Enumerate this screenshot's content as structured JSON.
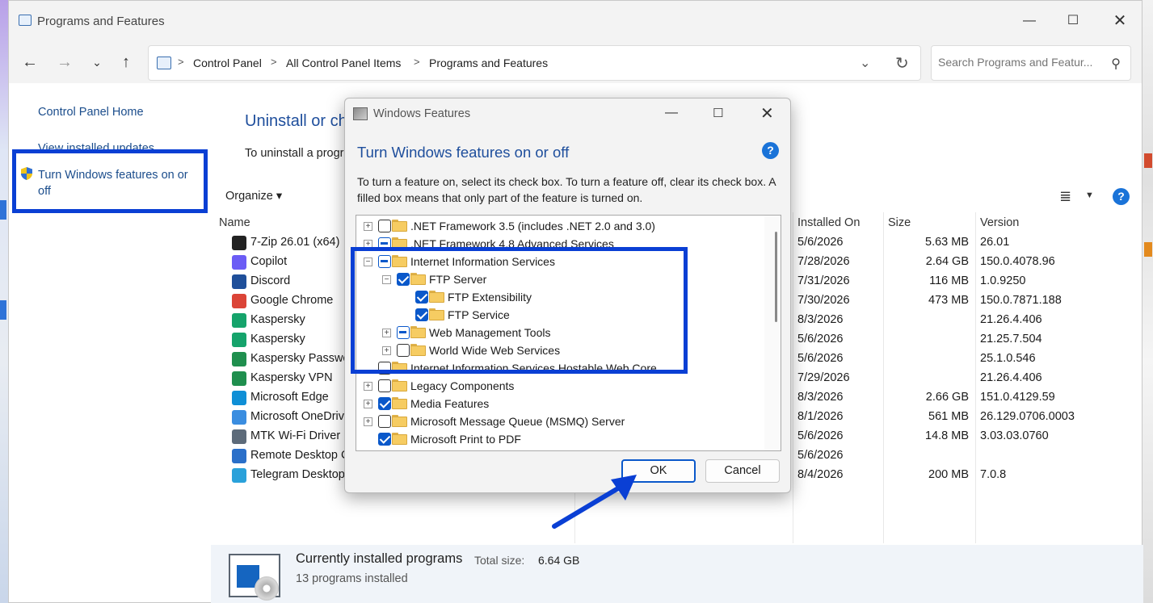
{
  "main_window": {
    "title": "Programs and Features",
    "minimize": "—",
    "maximize": "☐",
    "close": "✕"
  },
  "navigation": {
    "back": "←",
    "forward": "→",
    "recent": "⌄",
    "up": "↑",
    "breadcrumb": [
      "Control Panel",
      "All Control Panel Items",
      "Programs and Features"
    ],
    "breadcrumb_separator": ">",
    "dropdown": "⌄",
    "refresh": "↻",
    "search_placeholder": "Search Programs and Featur..."
  },
  "left_pane": {
    "home": "Control Panel Home",
    "updates": "View installed updates",
    "features": "Turn Windows features on or off"
  },
  "content": {
    "title": "Uninstall or change a program",
    "description": "To uninstall a program, select it from the list and then click Uninstall, Change, or Repair.",
    "organize": "Organize ▾",
    "columns": {
      "name": "Name",
      "installed_on": "Installed On",
      "size": "Size",
      "version": "Version"
    },
    "programs": [
      {
        "name": "7-Zip 26.01 (x64)",
        "date": "5/6/2026",
        "size": "5.63 MB",
        "version": "26.01",
        "icon_color": "#222222",
        "icon": "7zip-icon"
      },
      {
        "name": "Copilot",
        "date": "7/28/2026",
        "size": "2.64 GB",
        "version": "150.0.4078.96",
        "icon_color": "#6b5cf5",
        "icon": "copilot-icon"
      },
      {
        "name": "Discord",
        "date": "7/31/2026",
        "size": "116 MB",
        "version": "1.0.9250",
        "icon_color": "#1f4f9a",
        "icon": "discord-icon"
      },
      {
        "name": "Google Chrome",
        "date": "7/30/2026",
        "size": "473 MB",
        "version": "150.0.7871.188",
        "icon_color": "#db4437",
        "icon": "chrome-icon"
      },
      {
        "name": "Kaspersky",
        "date": "8/3/2026",
        "size": "",
        "version": "21.26.4.406",
        "icon_color": "#15a36b",
        "icon": "kaspersky-icon"
      },
      {
        "name": "Kaspersky",
        "date": "5/6/2026",
        "size": "",
        "version": "21.25.7.504",
        "icon_color": "#15a36b",
        "icon": "kaspersky-icon"
      },
      {
        "name": "Kaspersky Password Manager",
        "date": "5/6/2026",
        "size": "",
        "version": "25.1.0.546",
        "icon_color": "#1f8f4e",
        "icon": "kaspersky-password-icon"
      },
      {
        "name": "Kaspersky VPN",
        "date": "7/29/2026",
        "size": "",
        "version": "21.26.4.406",
        "icon_color": "#1f8f4e",
        "icon": "kaspersky-vpn-icon"
      },
      {
        "name": "Microsoft Edge",
        "date": "8/3/2026",
        "size": "2.66 GB",
        "version": "151.0.4129.59",
        "icon_color": "#0f8fd6",
        "icon": "edge-icon"
      },
      {
        "name": "Microsoft OneDrive",
        "date": "8/1/2026",
        "size": "561 MB",
        "version": "26.129.0706.0003",
        "icon_color": "#3a8de0",
        "icon": "onedrive-icon"
      },
      {
        "name": "MTK Wi-Fi Driver",
        "date": "5/6/2026",
        "size": "14.8 MB",
        "version": "3.03.03.0760",
        "icon_color": "#5d6b7a",
        "icon": "wifi-driver-icon"
      },
      {
        "name": "Remote Desktop Connection",
        "date": "5/6/2026",
        "size": "",
        "version": "",
        "icon_color": "#2a6fc9",
        "icon": "remote-desktop-icon"
      },
      {
        "name": "Telegram Desktop",
        "date": "8/4/2026",
        "size": "200 MB",
        "version": "7.0.8",
        "icon_color": "#2aa1da",
        "icon": "telegram-icon"
      }
    ]
  },
  "status_bar": {
    "title": "Currently installed programs",
    "total_label": "Total size:",
    "total_value": "6.64 GB",
    "count": "13 programs installed"
  },
  "dialog": {
    "title": "Windows Features",
    "minimize": "—",
    "maximize": "☐",
    "close": "✕",
    "heading": "Turn Windows features on or off",
    "help": "?",
    "description": "To turn a feature on, select its check box. To turn a feature off, clear its check box. A filled box means that only part of the feature is turned on.",
    "features": [
      {
        "label": ".NET Framework 3.5 (includes .NET 2.0 and 3.0)",
        "level": 0,
        "expander": "+",
        "state": "unchecked"
      },
      {
        "label": ".NET Framework 4.8 Advanced Services",
        "level": 0,
        "expander": "+",
        "state": "partial"
      },
      {
        "label": "Internet Information Services",
        "level": 0,
        "expander": "−",
        "state": "partial"
      },
      {
        "label": "FTP Server",
        "level": 1,
        "expander": "−",
        "state": "checked"
      },
      {
        "label": "FTP Extensibility",
        "level": 2,
        "expander": "",
        "state": "checked"
      },
      {
        "label": "FTP Service",
        "level": 2,
        "expander": "",
        "state": "checked"
      },
      {
        "label": "Web Management Tools",
        "level": 1,
        "expander": "+",
        "state": "partial"
      },
      {
        "label": "World Wide Web Services",
        "level": 1,
        "expander": "+",
        "state": "unchecked"
      },
      {
        "label": "Internet Information Services Hostable Web Core",
        "level": 0,
        "expander": "",
        "state": "unchecked"
      },
      {
        "label": "Legacy Components",
        "level": 0,
        "expander": "+",
        "state": "unchecked"
      },
      {
        "label": "Media Features",
        "level": 0,
        "expander": "+",
        "state": "checked"
      },
      {
        "label": "Microsoft Message Queue (MSMQ) Server",
        "level": 0,
        "expander": "+",
        "state": "unchecked"
      },
      {
        "label": "Microsoft Print to PDF",
        "level": 0,
        "expander": "",
        "state": "checked"
      }
    ],
    "ok": "OK",
    "cancel": "Cancel"
  },
  "colors": {
    "accent": "#0a58ca",
    "highlight_box": "#0a3fd4",
    "link": "#1b4d8c",
    "heading": "#1e4e9c"
  }
}
